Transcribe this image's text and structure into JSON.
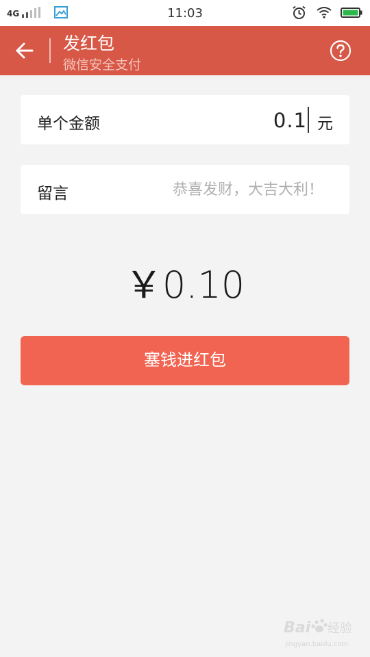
{
  "status_bar": {
    "network": "4G",
    "time": "11:03",
    "icons": [
      "signal-icon",
      "gallery-icon",
      "alarm-icon",
      "wifi-icon",
      "battery-icon"
    ],
    "battery_color": "#2db84b"
  },
  "header": {
    "title": "发红包",
    "subtitle": "微信安全支付",
    "background": "#d75847",
    "icons": [
      "back-arrow-icon",
      "help-icon"
    ]
  },
  "amount_field": {
    "label": "单个金额",
    "value": "0.1",
    "unit": "元"
  },
  "message_field": {
    "label": "留言",
    "placeholder": "恭喜发财，大吉大利！"
  },
  "total": {
    "display": "￥0.10"
  },
  "submit_button": {
    "label": "塞钱进红包",
    "color": "#f16451"
  },
  "watermark": {
    "logo": "Bai du 经验",
    "sub": "jingyan.baidu.com"
  }
}
